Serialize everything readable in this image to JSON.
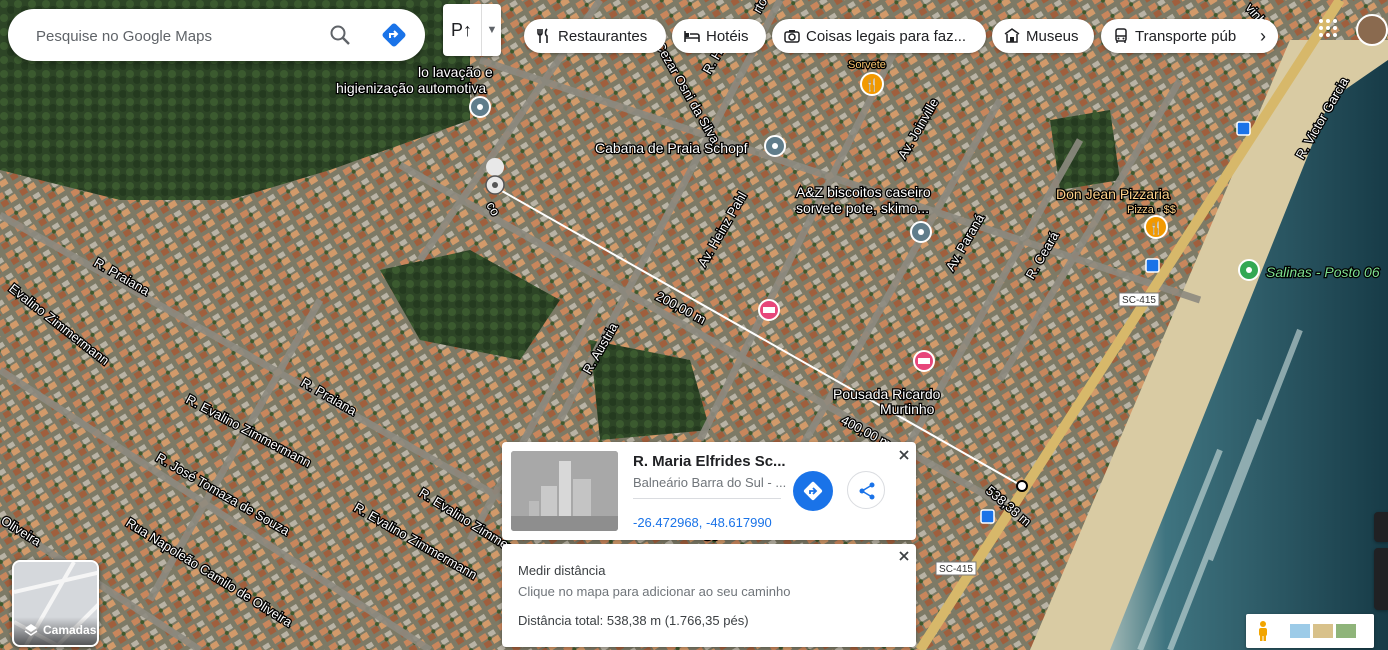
{
  "search": {
    "placeholder": "Pesquise no Google Maps"
  },
  "route_toggle": {
    "label": "P↑"
  },
  "chips": [
    {
      "label": "Restaurantes",
      "icon": "fork-knife-icon"
    },
    {
      "label": "Hotéis",
      "icon": "bed-icon"
    },
    {
      "label": "Coisas legais para faz...",
      "icon": "camera-icon"
    },
    {
      "label": "Museus",
      "icon": "museum-icon"
    },
    {
      "label": "Transporte púb",
      "icon": "bus-icon"
    }
  ],
  "map_labels": {
    "streets": [
      "R. Praiana",
      "R. Praiana",
      "Evalino Zimmermann",
      "R. Evalino Zimmermann",
      "R. Evalino Zimmermann",
      "R. José Tomaza de Souza",
      "Rua Napoleão Camilo de Oliveira",
      "R. Evalino Zimmermann",
      "Oliveira",
      "Cezar Osni da Silva",
      "Av. Heinz Pahl",
      "Av. Joinville",
      "Av. Paraná",
      "R. Ceará",
      "R. Victor Garcia",
      "R. Austria",
      "R. Hel",
      "rto",
      "co",
      "Sc",
      "vinhas"
    ],
    "road_badges": [
      "SC-415",
      "SC-415"
    ],
    "places": [
      {
        "name": "lo lavação e higienização automotiva",
        "sub": ""
      },
      {
        "name": "Sorvete",
        "sub": ""
      },
      {
        "name": "Cabana de Praia Schopf",
        "sub": ""
      },
      {
        "name": "A&Z biscoitos caseiro sorvete pote, skimo...",
        "sub": ""
      },
      {
        "name": "Don Jean Pizzaria",
        "sub": "Pizza · $$"
      },
      {
        "name": "Salinas - Posto 06",
        "sub": ""
      },
      {
        "name": "Pousada Ricardo Murtinho",
        "sub": ""
      }
    ],
    "distances": [
      "200,00 m",
      "400,00 m",
      "538,38 m"
    ]
  },
  "colors": {
    "route_line": "#ffffff",
    "gas_pin": "#f29900",
    "hotel_pin": "#e7467a",
    "place_pin": "#607d8b",
    "park_pin": "#34a853",
    "accent": "#1a73e8",
    "ocean": "#1f4450",
    "sand": "#dccfa8",
    "vegetation": "#2f4a27",
    "highway": "#d7b86a"
  },
  "place_card": {
    "title": "R. Maria Elfrides Sc...",
    "subtitle": "Balneário Barra do Sul - ...",
    "coordinates": "-26.472968, -48.617990"
  },
  "measure_card": {
    "title": "Medir distância",
    "hint": "Clique no mapa para adicionar ao seu caminho",
    "total": "Distância total: 538,38 m (1.766,35 pés)"
  },
  "layers": {
    "label": "Camadas"
  }
}
